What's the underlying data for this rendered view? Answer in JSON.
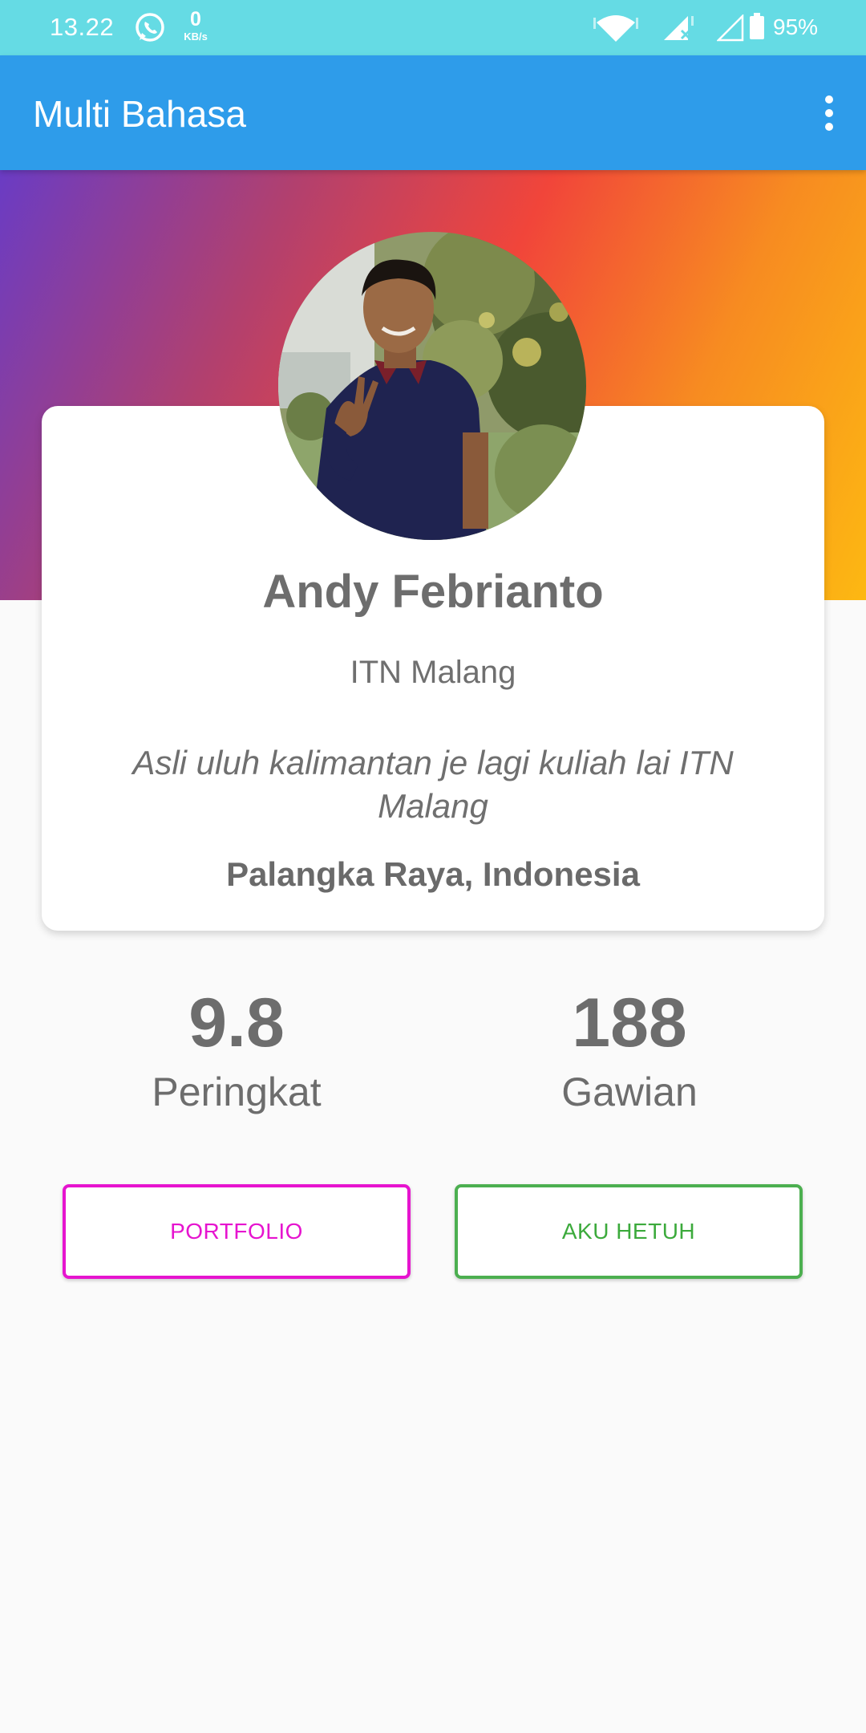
{
  "status_bar": {
    "time": "13.22",
    "net_speed_value": "0",
    "net_speed_unit": "KB/s",
    "battery": "95%"
  },
  "app_bar": {
    "title": "Multi Bahasa"
  },
  "profile": {
    "name": "Andy Febrianto",
    "organization": "ITN Malang",
    "bio": "Asli uluh kalimantan je lagi kuliah lai ITN Malang",
    "location": "Palangka Raya, Indonesia"
  },
  "stats": {
    "rating_value": "9.8",
    "rating_label": "Peringkat",
    "work_value": "188",
    "work_label": "Gawian"
  },
  "buttons": {
    "portfolio": "PORTFOLIO",
    "about": "AKU HETUH"
  },
  "colors": {
    "status_bar": "#65dbe4",
    "app_bar": "#2e9cea",
    "portfolio_accent": "#e614cf",
    "about_accent": "#4caf50"
  },
  "icons": [
    "whatsapp-icon",
    "wifi-icon",
    "signal-icon",
    "battery-icon",
    "more-vert-icon"
  ]
}
